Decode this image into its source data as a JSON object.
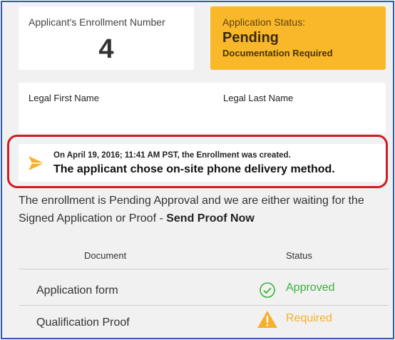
{
  "enrollment": {
    "label": "Applicant's Enrollment Number",
    "number": "4"
  },
  "application_status": {
    "label": "Application Status:",
    "value": "Pending",
    "sub": "Documentation Required",
    "color": "#f9b82a"
  },
  "names": {
    "first_label": "Legal First Name",
    "last_label": "Legal Last Name"
  },
  "event": {
    "icon": "send-arrow-icon",
    "line1": "On April 19, 2016; 11:41 AM PST, the Enrollment was created.",
    "line2": "The applicant chose on-site phone delivery method.",
    "highlight_color": "#d01c23"
  },
  "pending": {
    "text": "The enrollment is Pending Approval and we are either waiting for the Signed Application or Proof - ",
    "link": "Send Proof Now"
  },
  "documents": {
    "headers": {
      "document": "Document",
      "status": "Status"
    },
    "rows": [
      {
        "name": "Application form",
        "status": "Approved",
        "icon": "check-circle-icon",
        "color": "#3bb03b"
      },
      {
        "name": "Qualification Proof",
        "status": "Required",
        "icon": "warning-triangle-icon",
        "color": "#f6b12a"
      }
    ]
  }
}
